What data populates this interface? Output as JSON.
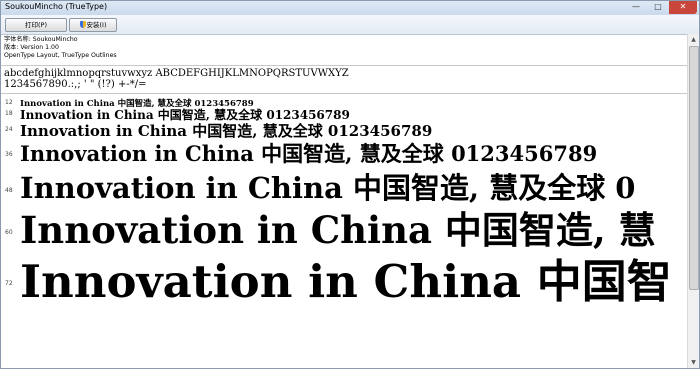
{
  "window": {
    "title": "SoukouMincho (TrueType)"
  },
  "toolbar": {
    "print_label": "打印(P)",
    "install_label": "安装(I)"
  },
  "info": {
    "font_name_line": "字体名称: SoukouMincho",
    "version_line": "版本: Version 1.00",
    "outline_line": "OpenType Layout, TrueType Outlines"
  },
  "charset": {
    "line1": "abcdefghijklmnopqrstuvwxyz ABCDEFGHIJKLMNOPQRSTUVWXYZ",
    "line2": "1234567890.:,; ' \" (!?) +-*/="
  },
  "samples": [
    {
      "size": "12",
      "text": "Innovation in China 中国智造, 慧及全球 0123456789"
    },
    {
      "size": "18",
      "text": "Innovation in China 中国智造, 慧及全球 0123456789"
    },
    {
      "size": "24",
      "text": "Innovation in China 中国智造, 慧及全球 0123456789"
    },
    {
      "size": "36",
      "text": "Innovation in China 中国智造, 慧及全球 0123456789"
    },
    {
      "size": "48",
      "text": "Innovation in China 中国智造, 慧及全球 0"
    },
    {
      "size": "60",
      "text": "Innovation in China 中国智造, 慧"
    },
    {
      "size": "72",
      "text": "Innovation in China 中国智"
    }
  ]
}
